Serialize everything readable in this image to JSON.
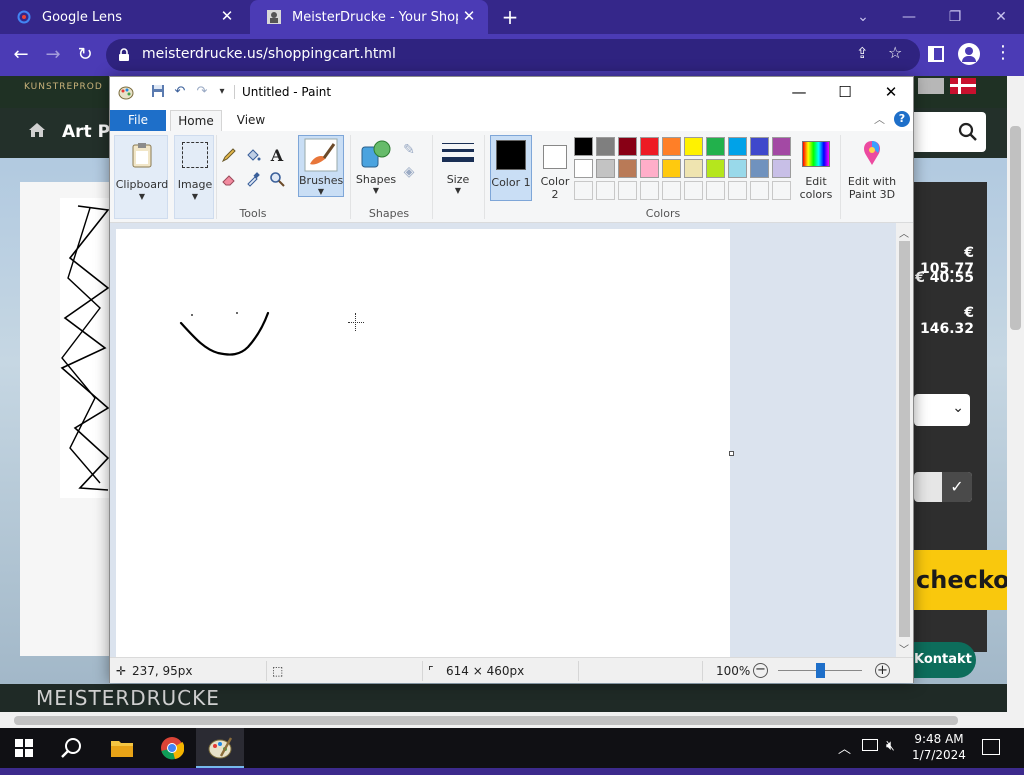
{
  "browser": {
    "tabs": [
      {
        "title": "Google Lens",
        "active": false
      },
      {
        "title": "MeisterDrucke - Your Shopping",
        "active": true
      }
    ],
    "url": "meisterdrucke.us/shoppingcart.html"
  },
  "website": {
    "nav_text": "Art Pri",
    "header_sub": "KUNSTREPROD",
    "prices": [
      "€ 105.77",
      "€ 40.55",
      "€ 146.32"
    ],
    "checkout_label": "checkou",
    "kontakt_label": "Kontakt",
    "footer_text": "MEISTERDRUCKE"
  },
  "paint": {
    "title": "Untitled - Paint",
    "tabs": {
      "file": "File",
      "home": "Home",
      "view": "View"
    },
    "groups": {
      "clipboard": "Clipboard",
      "image": "Image",
      "tools": "Tools",
      "brushes": "Brushes",
      "shapes_btn": "Shapes",
      "shapes_group": "Shapes",
      "size": "Size",
      "color1": "Color 1",
      "color2": "Color 2",
      "colors": "Colors",
      "edit_colors": "Edit colors",
      "edit_paint3d": "Edit with Paint 3D"
    },
    "palette_row1": [
      "#000000",
      "#7f7f7f",
      "#880015",
      "#ed1c24",
      "#ff7f27",
      "#fff200",
      "#22b14c",
      "#00a2e8",
      "#3f48cc",
      "#a349a4"
    ],
    "palette_row2": [
      "#ffffff",
      "#c3c3c3",
      "#b97a57",
      "#ffaec9",
      "#ffc90e",
      "#efe4b0",
      "#b5e61d",
      "#99d9ea",
      "#7092be",
      "#c8bfe7"
    ],
    "color1": "#000000",
    "color2": "#ffffff",
    "status": {
      "cursor_pos": "237, 95px",
      "canvas_size": "614 × 460px",
      "zoom": "100%"
    }
  },
  "taskbar": {
    "time": "9:48 AM",
    "date": "1/7/2024"
  }
}
